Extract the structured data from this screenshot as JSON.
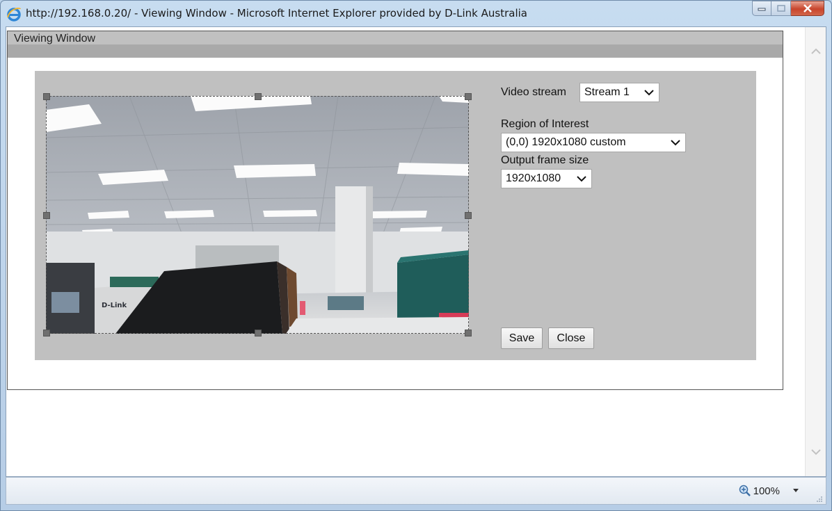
{
  "window": {
    "title": "http://192.168.0.20/ - Viewing Window - Microsoft Internet Explorer provided by D-Link Australia",
    "accent_color": "#c7dcf0",
    "close_color": "#c8452c"
  },
  "panel": {
    "title": "Viewing Window"
  },
  "video_stream": {
    "label": "Video stream",
    "selected": "Stream 1"
  },
  "roi": {
    "label": "Region of Interest",
    "selected": "(0,0) 1920x1080 custom"
  },
  "output_frame": {
    "label": "Output frame size",
    "selected": "1920x1080"
  },
  "buttons": {
    "save": "Save",
    "close": "Close"
  },
  "preview": {
    "logo_text": "D-Link"
  },
  "statusbar": {
    "zoom": "100%"
  },
  "icons": {
    "browser": "internet-explorer-icon",
    "zoom": "zoom-icon",
    "chevron": "chevron-down-icon"
  }
}
